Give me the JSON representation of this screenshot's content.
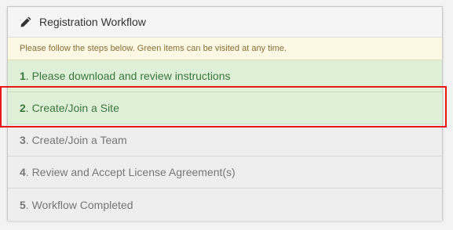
{
  "panel": {
    "title": "Registration Workflow",
    "notice": "Please follow the steps below. Green items can be visited at any time."
  },
  "steps": [
    {
      "num": "1",
      "label": ". Please download and review instructions",
      "state": "available"
    },
    {
      "num": "2",
      "label": ". Create/Join a Site",
      "state": "available"
    },
    {
      "num": "3",
      "label": ". Create/Join a Team",
      "state": "locked"
    },
    {
      "num": "4",
      "label": ". Review and Accept License Agreement(s)",
      "state": "locked"
    },
    {
      "num": "5",
      "label": ". Workflow Completed",
      "state": "locked"
    }
  ],
  "icons": {
    "header": "pencil-icon"
  },
  "colors": {
    "available_bg": "#dff0d8",
    "available_text": "#3c763d",
    "locked_bg": "#eeeeee",
    "locked_text": "#777777",
    "notice_bg": "#fcf8e3",
    "highlight": "#e81818"
  }
}
